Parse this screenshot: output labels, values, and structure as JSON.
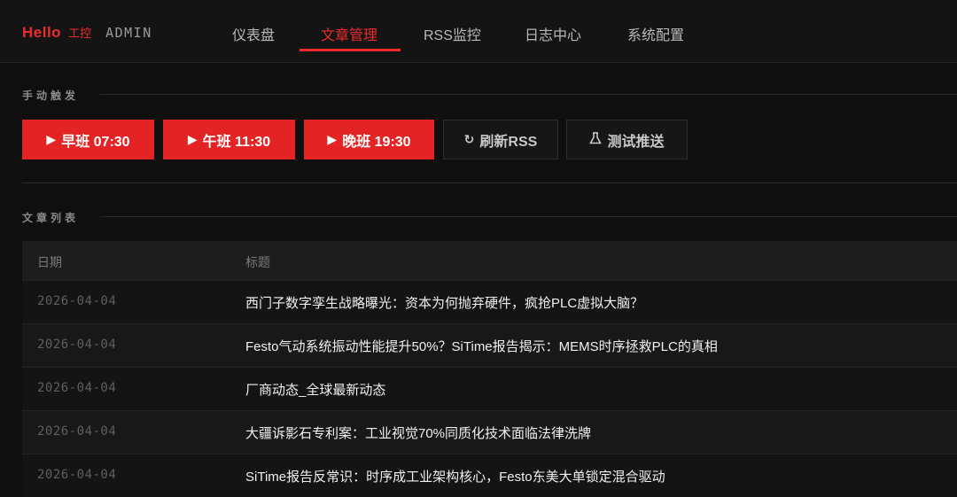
{
  "brand": {
    "hello": "Hello",
    "sub": "工控",
    "admin": "ADMIN",
    "accent": "#ee2b2b"
  },
  "nav": {
    "items": [
      {
        "label": "仪表盘"
      },
      {
        "label": "文章管理"
      },
      {
        "label": "RSS监控"
      },
      {
        "label": "日志中心"
      },
      {
        "label": "系统配置"
      }
    ],
    "active": "文章管理"
  },
  "manual": {
    "heading": "手动触发",
    "buttons": {
      "morning": {
        "icon": "play-icon",
        "label": "早班 07:30"
      },
      "noon": {
        "icon": "play-icon",
        "label": "午班 11:30"
      },
      "evening": {
        "icon": "play-icon",
        "label": "晚班 19:30"
      },
      "refresh": {
        "icon": "refresh-icon",
        "label": "刷新RSS"
      },
      "test": {
        "icon": "flask-icon",
        "label": "测试推送"
      }
    }
  },
  "articles": {
    "heading": "文章列表",
    "columns": {
      "date": "日期",
      "title": "标题"
    },
    "rows": [
      {
        "date": "2026-04-04",
        "title": "西门子数字孪生战略曝光：资本为何抛弃硬件，疯抢PLC虚拟大脑？"
      },
      {
        "date": "2026-04-04",
        "title": "Festo气动系统振动性能提升50%？SiTime报告揭示：MEMS时序拯救PLC的真相"
      },
      {
        "date": "2026-04-04",
        "title": "厂商动态_全球最新动态"
      },
      {
        "date": "2026-04-04",
        "title": "大疆诉影石专利案：工业视觉70%同质化技术面临法律洗牌"
      },
      {
        "date": "2026-04-04",
        "title": "SiTime报告反常识：时序成工业架构核心，Festo东美大单锁定混合驱动"
      }
    ]
  }
}
